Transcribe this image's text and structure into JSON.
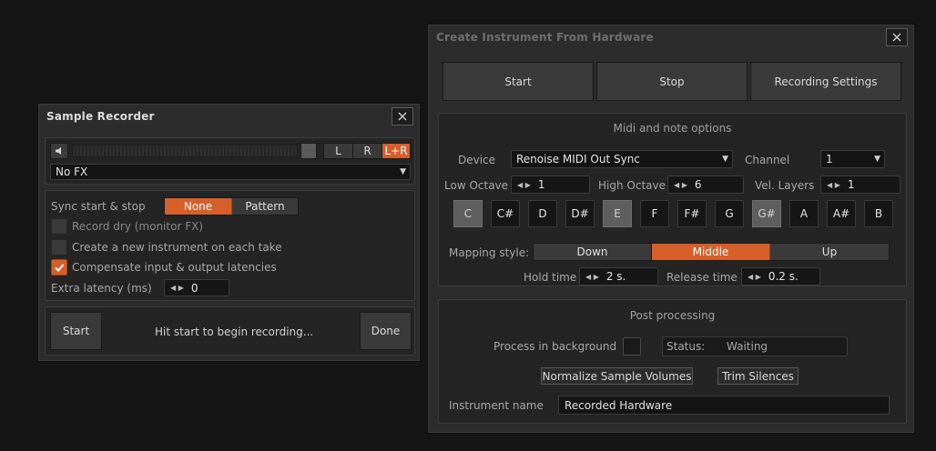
{
  "sample_recorder": {
    "title": "Sample Recorder",
    "channels": [
      "L",
      "R",
      "L+R"
    ],
    "fx_select": "No FX",
    "sync_label": "Sync start & stop",
    "sync_options": [
      "None",
      "Pattern"
    ],
    "sync_selected": "None",
    "record_dry_label": "Record dry (monitor FX)",
    "record_dry_checked": false,
    "new_instrument_label": "Create a new instrument on each take",
    "new_instrument_checked": false,
    "compensate_label": "Compensate input & output latencies",
    "compensate_checked": true,
    "extra_latency_label": "Extra latency (ms)",
    "extra_latency_value": "0",
    "start_label": "Start",
    "status_text": "Hit start to begin recording...",
    "done_label": "Done"
  },
  "create_instrument": {
    "title": "Create Instrument From Hardware",
    "toolbar": {
      "start": "Start",
      "stop": "Stop",
      "settings": "Recording Settings"
    },
    "midi_section_title": "Midi and note options",
    "device_label": "Device",
    "device_value": "Renoise MIDI Out Sync",
    "channel_label": "Channel",
    "channel_value": "1",
    "low_octave_label": "Low Octave",
    "low_octave_value": "1",
    "high_octave_label": "High Octave",
    "high_octave_value": "6",
    "vel_layers_label": "Vel. Layers",
    "vel_layers_value": "1",
    "notes": [
      {
        "name": "C",
        "selected": true
      },
      {
        "name": "C#",
        "selected": false
      },
      {
        "name": "D",
        "selected": false
      },
      {
        "name": "D#",
        "selected": false
      },
      {
        "name": "E",
        "selected": true
      },
      {
        "name": "F",
        "selected": false
      },
      {
        "name": "F#",
        "selected": false
      },
      {
        "name": "G",
        "selected": false
      },
      {
        "name": "G#",
        "selected": true
      },
      {
        "name": "A",
        "selected": false
      },
      {
        "name": "A#",
        "selected": false
      },
      {
        "name": "B",
        "selected": false
      }
    ],
    "mapping_label": "Mapping style:",
    "mapping_options": [
      "Down",
      "Middle",
      "Up"
    ],
    "mapping_selected": "Middle",
    "hold_time_label": "Hold time",
    "hold_time_value": "2 s.",
    "release_time_label": "Release time",
    "release_time_value": "0.2 s.",
    "post_section_title": "Post processing",
    "process_bg_label": "Process in background",
    "process_bg_checked": false,
    "status_label": "Status:",
    "status_value": "Waiting",
    "normalize_label": "Normalize Sample Volumes",
    "trim_label": "Trim Silences",
    "instrument_name_label": "Instrument name",
    "instrument_name_value": "Recorded Hardware"
  },
  "colors": {
    "accent": "#d65f2a",
    "background": "#151515",
    "window": "#2c2c2c",
    "panel": "#242424"
  }
}
